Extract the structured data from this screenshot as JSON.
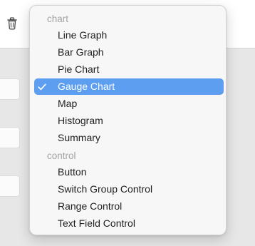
{
  "menu": {
    "sections": [
      {
        "label": "chart",
        "items": [
          {
            "label": "Line Graph",
            "selected": false
          },
          {
            "label": "Bar Graph",
            "selected": false
          },
          {
            "label": "Pie Chart",
            "selected": false
          },
          {
            "label": "Gauge Chart",
            "selected": true
          },
          {
            "label": "Map",
            "selected": false
          },
          {
            "label": "Histogram",
            "selected": false
          },
          {
            "label": "Summary",
            "selected": false
          }
        ]
      },
      {
        "label": "control",
        "items": [
          {
            "label": "Button",
            "selected": false
          },
          {
            "label": "Switch Group Control",
            "selected": false
          },
          {
            "label": "Range Control",
            "selected": false
          },
          {
            "label": "Text Field Control",
            "selected": false
          }
        ]
      }
    ]
  },
  "toolbar": {
    "icon": "trash-icon"
  },
  "colors": {
    "selection": "#5d9ef0",
    "section_header": "#a3a3a3",
    "text": "#1e1e1e"
  }
}
